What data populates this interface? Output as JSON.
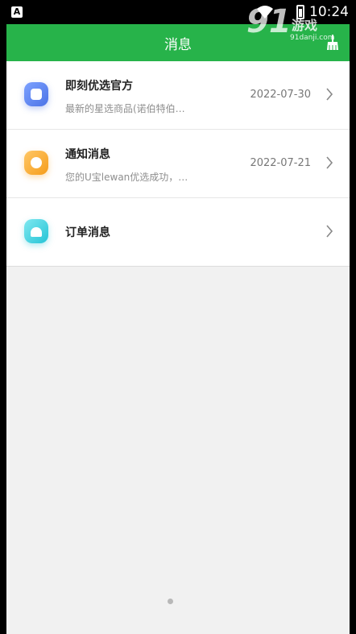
{
  "status_bar": {
    "badge": "A",
    "time": "10:24"
  },
  "watermark": {
    "number": "91",
    "brand": "游戏",
    "url": "91danji.com"
  },
  "app_bar": {
    "title": "消息",
    "action_icon": "broom-clear-icon"
  },
  "messages": [
    {
      "title": "即刻优选官方",
      "preview": "最新的星选商品(诺伯特伯…",
      "date": "2022-07-30",
      "icon": "shopping-bag-icon",
      "color": "#5a7ff0"
    },
    {
      "title": "通知消息",
      "preview": "您的U宝lewan优选成功，…",
      "date": "2022-07-21",
      "icon": "notification-icon",
      "color": "#f7a92b"
    },
    {
      "title": "订单消息",
      "preview": "",
      "date": "",
      "icon": "order-icon",
      "color": "#3fd0de"
    }
  ],
  "colors": {
    "accent": "#27b34a",
    "background": "#f1f1f1"
  }
}
